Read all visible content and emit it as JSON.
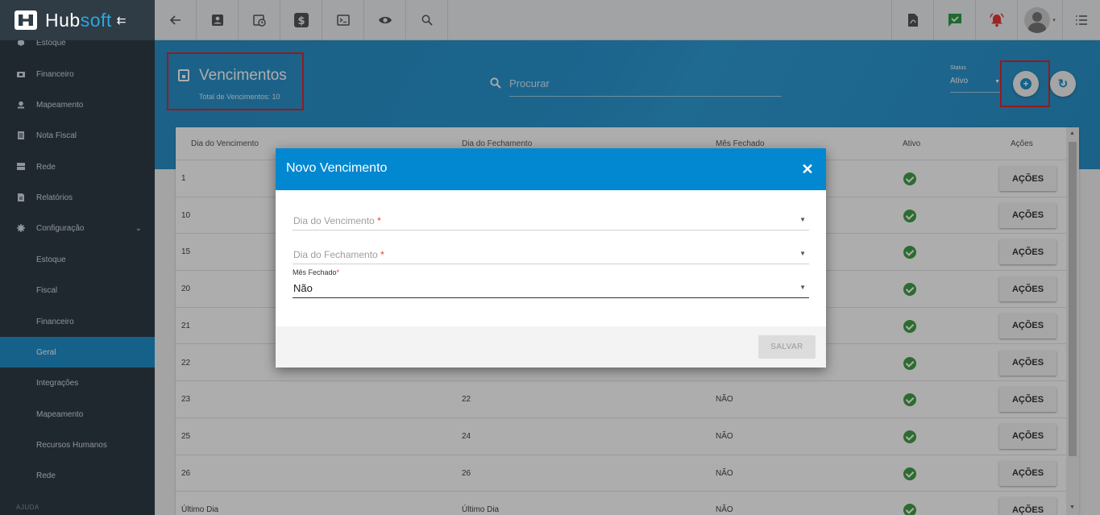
{
  "app": {
    "logo_hub": "Hub",
    "logo_soft": "soft"
  },
  "sidebar": {
    "items": [
      {
        "label": "Estoque",
        "icon": "box-icon"
      },
      {
        "label": "Financeiro",
        "icon": "money-icon"
      },
      {
        "label": "Mapeamento",
        "icon": "map-pin-icon"
      },
      {
        "label": "Nota Fiscal",
        "icon": "document-icon"
      },
      {
        "label": "Rede",
        "icon": "server-icon"
      },
      {
        "label": "Relatórios",
        "icon": "report-icon"
      },
      {
        "label": "Configuração",
        "icon": "gear-icon"
      }
    ],
    "sub_items": [
      {
        "label": "Estoque"
      },
      {
        "label": "Fiscal"
      },
      {
        "label": "Financeiro"
      },
      {
        "label": "Geral",
        "active": true
      },
      {
        "label": "Integrações"
      },
      {
        "label": "Mapeamento"
      },
      {
        "label": "Recursos Humanos"
      },
      {
        "label": "Rede"
      }
    ],
    "help_label": "AJUDA"
  },
  "header": {
    "title": "Vencimentos",
    "subtitle": "Total de Vencimentos: 10",
    "search_placeholder": "Procurar",
    "status_label": "Status",
    "status_value": "Ativo"
  },
  "table": {
    "columns": [
      "Dia do Vencimento",
      "Dia do Fechamento",
      "Mês Fechado",
      "Ativo",
      "Ações"
    ],
    "action_label": "AÇÕES",
    "rows": [
      {
        "vencimento": "1",
        "fechamento": "",
        "mes": ""
      },
      {
        "vencimento": "10",
        "fechamento": "",
        "mes": ""
      },
      {
        "vencimento": "15",
        "fechamento": "",
        "mes": ""
      },
      {
        "vencimento": "20",
        "fechamento": "",
        "mes": ""
      },
      {
        "vencimento": "21",
        "fechamento": "",
        "mes": ""
      },
      {
        "vencimento": "22",
        "fechamento": "",
        "mes": ""
      },
      {
        "vencimento": "23",
        "fechamento": "22",
        "mes": "NÃO"
      },
      {
        "vencimento": "25",
        "fechamento": "24",
        "mes": "NÃO"
      },
      {
        "vencimento": "26",
        "fechamento": "26",
        "mes": "NÃO"
      },
      {
        "vencimento": "Último Dia",
        "fechamento": "Último Dia",
        "mes": "NÃO"
      }
    ]
  },
  "modal": {
    "title": "Novo Vencimento",
    "close": "✕",
    "field_vencimento": "Dia do Vencimento",
    "field_fechamento": "Dia do Fechamento",
    "field_mes_label": "Mês Fechado",
    "field_mes_value": "Não",
    "required_mark": "*",
    "save_label": "SALVAR"
  },
  "colors": {
    "brand_blue": "#0288d1",
    "sidebar_bg": "#2f3b45",
    "active_green": "#43a047",
    "highlight_red": "#e0252a"
  }
}
